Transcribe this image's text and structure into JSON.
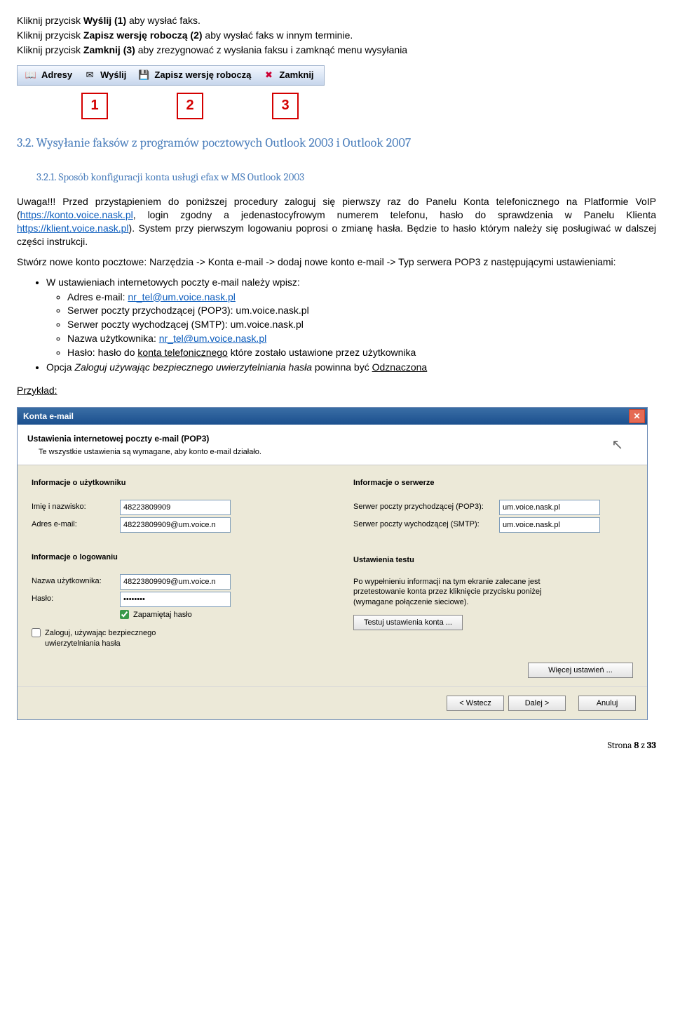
{
  "intro": {
    "l1a": "Kliknij przycisk ",
    "l1b": "Wyślij (1)",
    "l1c": " aby wysłać faks.",
    "l2a": "Kliknij przycisk ",
    "l2b": "Zapisz wersję roboczą (2)",
    "l2c": " aby wysłać faks w innym terminie.",
    "l3a": "Kliknij przycisk ",
    "l3b": "Zamknij (3)",
    "l3c": " aby zrezygnować z wysłania faksu i zamknąć menu wysyłania"
  },
  "toolbar": {
    "adresy": "Adresy",
    "wyslij": "Wyślij",
    "zapisz": "Zapisz wersję roboczą",
    "zamknij": "Zamknij"
  },
  "callouts": {
    "n1": "1",
    "n2": "2",
    "n3": "3"
  },
  "headings": {
    "h32": "3.2. Wysyłanie faksów z programów pocztowych Outlook 2003 i Outlook 2007",
    "h321": "3.2.1. Sposób konfiguracji konta usługi efax w MS Outlook 2003"
  },
  "para": {
    "uwaga_pre": "Uwaga!!! Przed przystąpieniem do poniższej procedury zaloguj się pierwszy raz do Panelu Konta telefonicznego na Platformie VoIP (",
    "link1_txt": "https://konto.voice.nask.pl",
    "uwaga_mid": ", login zgodny a jedenastocyfrowym numerem telefonu, hasło do sprawdzenia w Panelu Klienta ",
    "link2_txt": "https://klient.voice.nask.pl",
    "uwaga_post": "). System przy pierwszym logowaniu poprosi o zmianę hasła. Będzie to hasło którym należy się posługiwać w dalszej części instrukcji.",
    "stworz": "Stwórz nowe konto pocztowe: Narzędzia -> Konta e-mail -> dodaj nowe konto e-mail -> Typ serwera POP3 z następującymi ustawieniami:"
  },
  "bullets": {
    "top1": "W ustawieniach internetowych poczty e-mail należy wpisz:",
    "i1a": "Adres e-mail: ",
    "i1b": "nr_tel@um.voice.nask.pl",
    "i2": "Serwer poczty przychodzącej (POP3): um.voice.nask.pl",
    "i3": "Serwer poczty wychodzącej (SMTP): um.voice.nask.pl",
    "i4a": "Nazwa użytkownika: ",
    "i4b": "nr_tel@um.voice.nask.pl",
    "i5a": "Hasło: hasło do ",
    "i5b": "konta telefonicznego",
    "i5c": " które zostało ustawione przez użytkownika",
    "top2a": "Opcja ",
    "top2b": "Zaloguj używając bezpiecznego uwierzytelniania hasła",
    "top2c": " powinna być ",
    "top2d": "Odznaczona"
  },
  "example_label": "Przykład:",
  "dlg": {
    "title": "Konta e-mail",
    "hdr_main": "Ustawienia internetowej poczty e-mail (POP3)",
    "hdr_sub": "Te wszystkie ustawienia są wymagane, aby konto e-mail działało.",
    "grp_user": "Informacje o użytkowniku",
    "lbl_name": "Imię i nazwisko:",
    "val_name": "48223809909",
    "lbl_email": "Adres e-mail:",
    "val_email": "48223809909@um.voice.n",
    "grp_login": "Informacje o logowaniu",
    "lbl_user": "Nazwa użytkownika:",
    "val_user": "48223809909@um.voice.n",
    "lbl_pass": "Hasło:",
    "val_pass": "********",
    "chk_remember": "Zapamiętaj hasło",
    "chk_secure1": "Zaloguj, używając bezpiecznego",
    "chk_secure2": "uwierzytelniania hasła",
    "grp_srv": "Informacje o serwerze",
    "lbl_pop3": "Serwer poczty przychodzącej (POP3):",
    "val_pop3": "um.voice.nask.pl",
    "lbl_smtp": "Serwer poczty wychodzącej (SMTP):",
    "val_smtp": "um.voice.nask.pl",
    "grp_test": "Ustawienia testu",
    "test_desc": "Po wypełnieniu informacji na tym ekranie zalecane jest przetestowanie konta przez kliknięcie przycisku poniżej (wymagane połączenie sieciowe).",
    "btn_test": "Testuj ustawienia konta ...",
    "btn_more": "Więcej ustawień ...",
    "btn_back": "< Wstecz",
    "btn_next": "Dalej >",
    "btn_cancel": "Anuluj"
  },
  "footer": {
    "lbl": "Strona ",
    "cur": "8",
    "of": " z ",
    "total": "33"
  }
}
